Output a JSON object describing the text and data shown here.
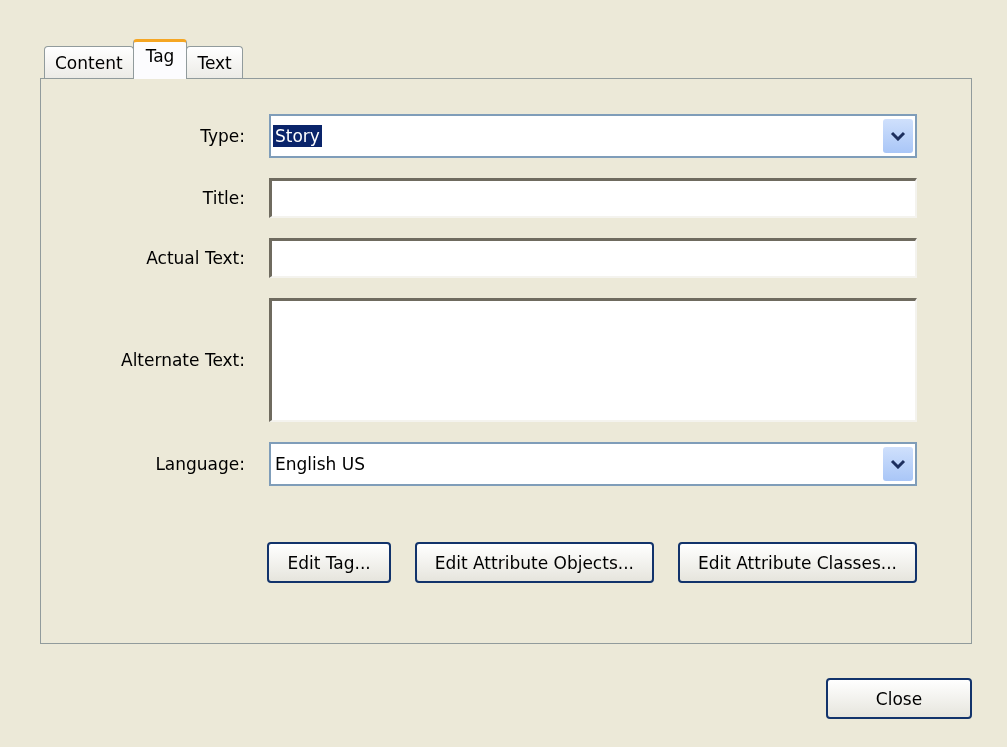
{
  "tabs": [
    {
      "label": "Content",
      "selected": false
    },
    {
      "label": "Tag",
      "selected": true
    },
    {
      "label": "Text",
      "selected": false
    }
  ],
  "fields": [
    {
      "kind": "dropdown",
      "label": "Type:",
      "value": "Story",
      "highlighted": true
    },
    {
      "kind": "text",
      "label": "Title:"
    },
    {
      "kind": "text",
      "label": "Actual Text:"
    },
    {
      "kind": "textarea",
      "label": "Alternate Text:"
    },
    {
      "kind": "dropdown",
      "label": "Language:",
      "value": "English US",
      "highlighted": false
    }
  ],
  "buttons": [
    "Edit Tag...",
    "Edit Attribute Objects...",
    "Edit Attribute Classes..."
  ],
  "close_button": "Close"
}
